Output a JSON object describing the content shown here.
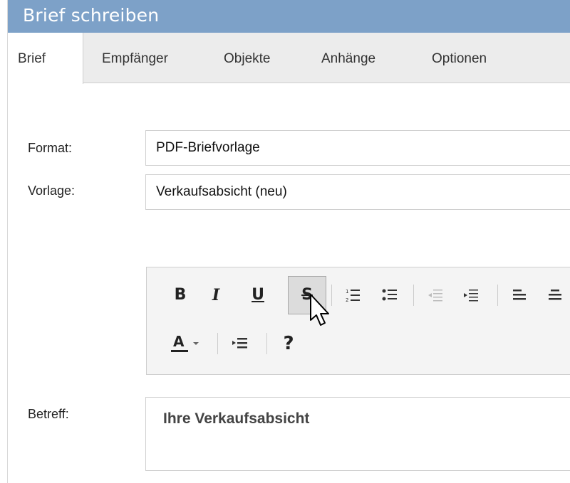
{
  "window": {
    "title": "Brief schreiben"
  },
  "tabs": [
    {
      "label": "Brief",
      "active": true
    },
    {
      "label": "Empfänger",
      "active": false
    },
    {
      "label": "Objekte",
      "active": false
    },
    {
      "label": "Anhänge",
      "active": false
    },
    {
      "label": "Optionen",
      "active": false
    }
  ],
  "form": {
    "format_label": "Format:",
    "format_value": "PDF-Briefvorlage",
    "vorlage_label": "Vorlage:",
    "vorlage_value": "Verkaufsabsicht (neu)",
    "betreff_label": "Betreff:",
    "betreff_value": "Ihre Verkaufsabsicht"
  },
  "toolbar": {
    "bold": "B",
    "italic": "I",
    "underline": "U",
    "strikethrough": "S",
    "font_color": "A",
    "help": "?"
  },
  "colors": {
    "title_bar": "#7da1c8",
    "tab_bar": "#ececec",
    "editor_bg": "#f4f4f4"
  }
}
